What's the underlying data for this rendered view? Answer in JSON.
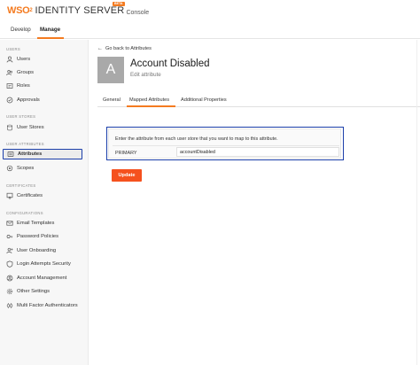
{
  "brand": {
    "logo_wso": "WSO",
    "logo_two": "2",
    "product": "IDENTITY SERVER",
    "console": "Console",
    "badge": "BETA",
    "accent_color": "#f47b20"
  },
  "nav": {
    "tabs": [
      {
        "label": "Develop"
      },
      {
        "label": "Manage"
      }
    ]
  },
  "sidebar": {
    "sections": [
      {
        "title": "USERS"
      },
      {
        "title": "USER STORES"
      },
      {
        "title": "USER ATTRIBUTES"
      },
      {
        "title": "CERTIFICATES"
      },
      {
        "title": "CONFIGURATIONS"
      }
    ],
    "items": [
      {
        "label": "Users",
        "icon": "user-icon"
      },
      {
        "label": "Groups",
        "icon": "groups-icon"
      },
      {
        "label": "Roles",
        "icon": "roles-icon"
      },
      {
        "label": "Approvals",
        "icon": "approvals-icon"
      },
      {
        "label": "User Stores",
        "icon": "database-icon"
      },
      {
        "label": "Attributes",
        "icon": "attributes-icon"
      },
      {
        "label": "Scopes",
        "icon": "scopes-icon"
      },
      {
        "label": "Certificates",
        "icon": "certificate-icon"
      },
      {
        "label": "Email Templates",
        "icon": "email-icon"
      },
      {
        "label": "Password Policies",
        "icon": "key-icon"
      },
      {
        "label": "User Onboarding",
        "icon": "onboarding-icon"
      },
      {
        "label": "Login Attempts Security",
        "icon": "shield-icon"
      },
      {
        "label": "Account Management",
        "icon": "account-management-icon"
      },
      {
        "label": "Other Settings",
        "icon": "gear-icon"
      },
      {
        "label": "Multi Factor Authenticators",
        "icon": "mfa-icon"
      }
    ]
  },
  "content": {
    "back_link": "Go back to Attributes",
    "avatar_letter": "A",
    "title": "Account Disabled",
    "subtitle": "Edit attribute",
    "tabs": [
      {
        "label": "General"
      },
      {
        "label": "Mapped Attributes"
      },
      {
        "label": "Additional Properties"
      }
    ],
    "mapping": {
      "description": "Enter the attribute from each user store that you want to map to this attribute.",
      "store_label": "PRIMARY",
      "attribute_value": "accountDisabled"
    },
    "update_label": "Update",
    "update_color": "#f5511e"
  }
}
